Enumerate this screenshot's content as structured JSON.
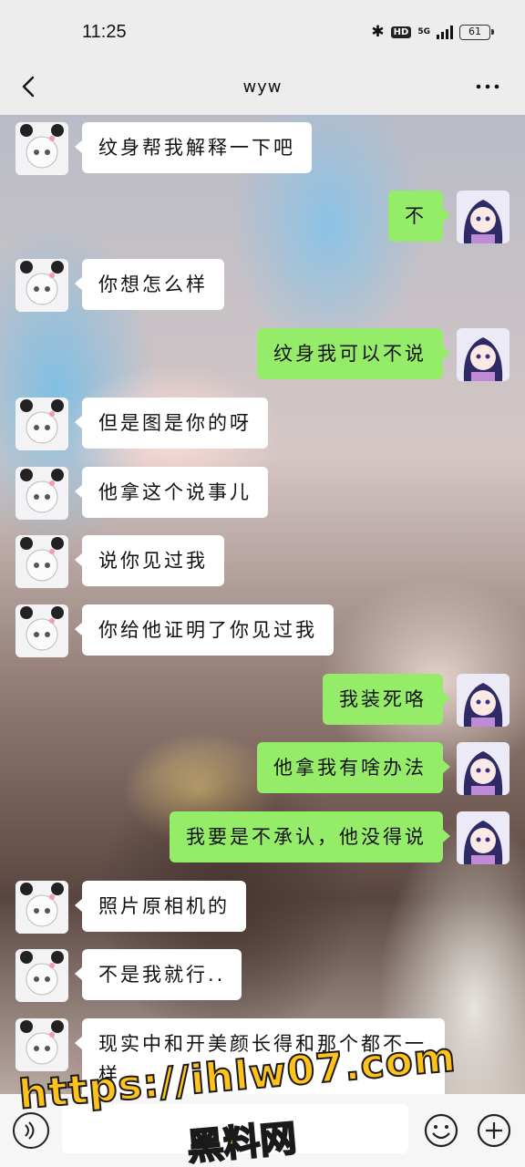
{
  "status_bar": {
    "time": "11:25",
    "hd_label": "HD",
    "network_label": "5G",
    "battery_level": "61"
  },
  "header": {
    "title": "wyw",
    "back_icon": "chevron-left-icon",
    "more_icon": "more-dots-icon"
  },
  "messages": [
    {
      "side": "left",
      "text": "纹身帮我解释一下吧"
    },
    {
      "side": "right",
      "text": "不"
    },
    {
      "side": "left",
      "text": "你想怎么样"
    },
    {
      "side": "right",
      "text": "纹身我可以不说"
    },
    {
      "side": "left",
      "text": "但是图是你的呀"
    },
    {
      "side": "left",
      "text": "他拿这个说事儿"
    },
    {
      "side": "left",
      "text": "说你见过我"
    },
    {
      "side": "left",
      "text": "你给他证明了你见过我"
    },
    {
      "side": "right",
      "text": "我装死咯"
    },
    {
      "side": "right",
      "text": "他拿我有啥办法"
    },
    {
      "side": "right",
      "text": "我要是不承认，他没得说"
    },
    {
      "side": "left",
      "text": "照片原相机的"
    },
    {
      "side": "left",
      "text": "不是我就行.."
    },
    {
      "side": "left",
      "text": "现实中和开美颜长得和那个都不一样"
    }
  ],
  "input_bar": {
    "voice_icon": "voice-icon",
    "emoji_icon": "emoji-icon",
    "plus_icon": "plus-icon"
  },
  "watermark": {
    "line1": "https://ihlw07.com",
    "line2": "黑料网"
  },
  "colors": {
    "self_bubble": "#95ec69",
    "other_bubble": "#ffffff",
    "bar_background": "#ededed"
  }
}
